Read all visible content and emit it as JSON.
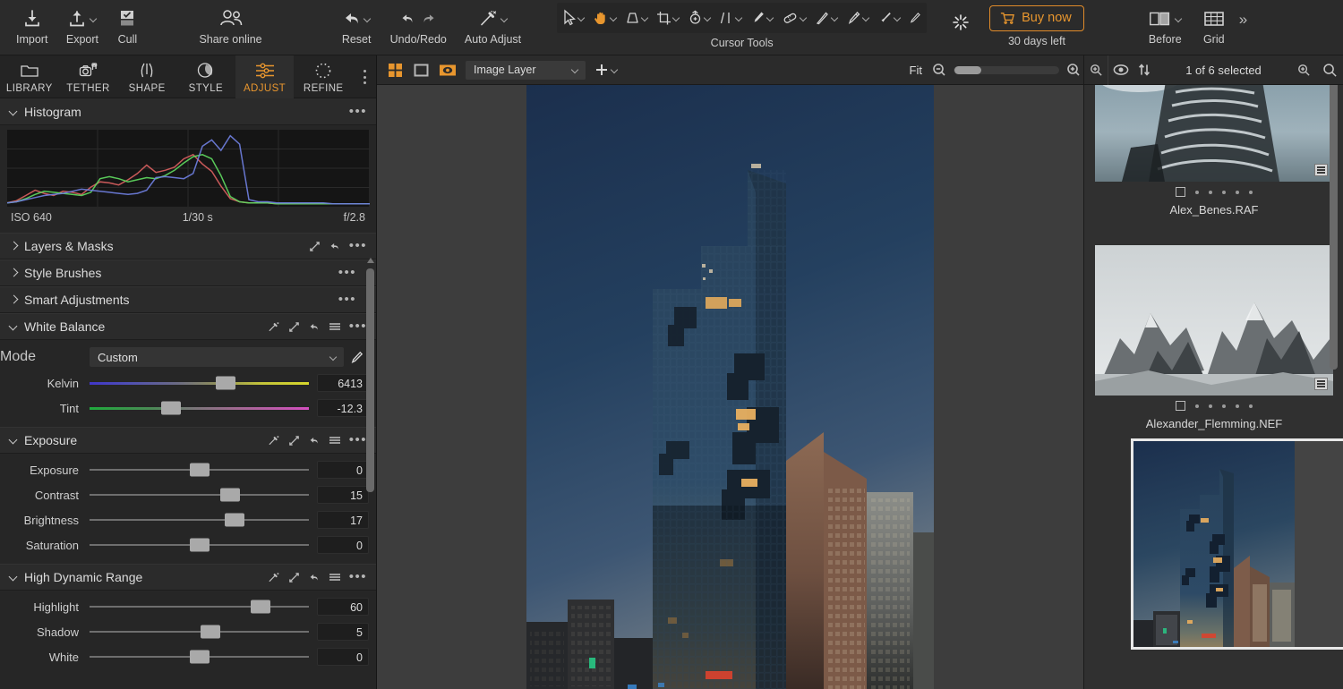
{
  "app": {
    "accent": "#e8962e",
    "panel_bg": "#262626",
    "toolbar_bg": "#2b2b2b"
  },
  "toolbar": {
    "items": [
      {
        "label": "Import",
        "icon": "import-icon",
        "caret": false
      },
      {
        "label": "Export",
        "icon": "export-icon",
        "caret": true
      },
      {
        "label": "Cull",
        "icon": "cull-icon",
        "caret": false
      },
      {
        "label": "Share online",
        "icon": "share-online-icon",
        "caret": false
      },
      {
        "label": "Reset",
        "icon": "reset-icon",
        "caret": true
      },
      {
        "label": "Undo/Redo",
        "icon": "undo-redo-icon",
        "caret": false
      },
      {
        "label": "Auto Adjust",
        "icon": "auto-adjust-icon",
        "caret": true
      }
    ],
    "cursor_tools_label": "Cursor Tools",
    "cursor_tools": [
      {
        "name": "select-tool",
        "active": false
      },
      {
        "name": "pan-tool",
        "active": true
      },
      {
        "name": "keystone-tool",
        "active": false
      },
      {
        "name": "crop-tool",
        "active": false
      },
      {
        "name": "rotate-tool",
        "active": false
      },
      {
        "name": "straighten-tool",
        "active": false
      },
      {
        "name": "brush-tool",
        "active": false
      },
      {
        "name": "heal-tool",
        "active": false
      },
      {
        "name": "gradient-mask-tool",
        "active": false
      },
      {
        "name": "color-picker-tool",
        "active": false
      },
      {
        "name": "dodge-tool",
        "active": false
      },
      {
        "name": "erase-tool",
        "active": false
      }
    ],
    "magic_icon": "magic-wand-icon",
    "buy_label": "Buy now",
    "trial_label": "30 days left",
    "before_label": "Before",
    "grid_label": "Grid",
    "overflow_label": "»"
  },
  "left_panel": {
    "tabs": [
      {
        "label": "LIBRARY",
        "icon": "folder-icon",
        "active": false
      },
      {
        "label": "TETHER",
        "icon": "tether-camera-icon",
        "active": false
      },
      {
        "label": "SHAPE",
        "icon": "shape-icon",
        "active": false
      },
      {
        "label": "STYLE",
        "icon": "style-icon",
        "active": false
      },
      {
        "label": "ADJUST",
        "icon": "adjust-sliders-icon",
        "active": true
      },
      {
        "label": "REFINE",
        "icon": "refine-icon",
        "active": false
      }
    ],
    "sections": [
      {
        "id": "histogram",
        "title": "Histogram",
        "open": true,
        "iso": "ISO 640",
        "shutter": "1/30 s",
        "aperture": "f/2.8"
      },
      {
        "id": "layers_masks",
        "title": "Layers & Masks",
        "open": false
      },
      {
        "id": "style_brushes",
        "title": "Style Brushes",
        "open": false
      },
      {
        "id": "smart_adjustments",
        "title": "Smart Adjustments",
        "open": false
      },
      {
        "id": "white_balance",
        "title": "White Balance",
        "open": true,
        "mode_label": "Mode",
        "mode_value": "Custom",
        "sliders": [
          {
            "label": "Kelvin",
            "value": "6413",
            "pos": 62,
            "style": "kelvin"
          },
          {
            "label": "Tint",
            "value": "-12.3",
            "pos": 37,
            "style": "tint"
          }
        ]
      },
      {
        "id": "exposure",
        "title": "Exposure",
        "open": true,
        "sliders": [
          {
            "label": "Exposure",
            "value": "0",
            "pos": 50,
            "style": "plain"
          },
          {
            "label": "Contrast",
            "value": "15",
            "pos": 64,
            "style": "plain"
          },
          {
            "label": "Brightness",
            "value": "17",
            "pos": 66,
            "style": "plain"
          },
          {
            "label": "Saturation",
            "value": "0",
            "pos": 50,
            "style": "plain"
          }
        ]
      },
      {
        "id": "hdr",
        "title": "High Dynamic Range",
        "open": true,
        "sliders": [
          {
            "label": "Highlight",
            "value": "60",
            "pos": 78,
            "style": "plain"
          },
          {
            "label": "Shadow",
            "value": "5",
            "pos": 55,
            "style": "plain"
          },
          {
            "label": "White",
            "value": "0",
            "pos": 50,
            "style": "plain"
          }
        ]
      }
    ]
  },
  "viewer_bar": {
    "grid_view_icon": "grid-view-icon",
    "single_view_icon": "single-view-icon",
    "preview_icon": "preview-eye-icon",
    "layer_value": "Image Layer",
    "add_layer_icon": "plus-icon",
    "fit_label": "Fit",
    "zoom_out_icon": "zoom-out-icon",
    "zoom_in_icon": "zoom-in-icon"
  },
  "browser_bar": {
    "eye_icon": "visibility-icon",
    "sort_icon": "sort-arrows-icon",
    "selection_text": "1 of 6 selected",
    "filter_icon": "filter-zoom-icon",
    "search_icon": "search-icon"
  },
  "browser": {
    "thumbnails": [
      {
        "name": "Alex_Benes.RAF",
        "selected": false,
        "subject": "spiral-building-bw"
      },
      {
        "name": "Alexander_Flemming.NEF",
        "selected": false,
        "subject": "mountains-bw"
      },
      {
        "name": "",
        "selected": true,
        "subject": "skyscraper-dusk"
      }
    ]
  },
  "viewer": {
    "image_alt": "skyscraper-at-dusk"
  },
  "chart_data": {
    "type": "line",
    "title": "Histogram",
    "xlabel": "",
    "ylabel": "",
    "series": [
      {
        "name": "red",
        "color": "#d95f5f",
        "values": [
          2,
          4,
          9,
          14,
          11,
          9,
          13,
          12,
          10,
          17,
          22,
          21,
          19,
          24,
          30,
          38,
          31,
          33,
          36,
          44,
          48,
          39,
          32,
          18,
          6,
          3,
          2,
          2,
          2,
          1,
          1,
          1,
          1,
          1,
          1,
          1,
          1,
          1,
          1,
          1
        ]
      },
      {
        "name": "green",
        "color": "#5fd95f",
        "values": [
          2,
          3,
          6,
          10,
          13,
          12,
          11,
          10,
          9,
          12,
          25,
          27,
          25,
          22,
          24,
          26,
          25,
          28,
          33,
          40,
          46,
          48,
          44,
          28,
          8,
          3,
          2,
          2,
          2,
          1,
          1,
          1,
          1,
          1,
          1,
          1,
          1,
          1,
          1,
          1
        ]
      },
      {
        "name": "blue",
        "color": "#6f7fe0",
        "values": [
          2,
          3,
          5,
          7,
          9,
          10,
          11,
          13,
          15,
          14,
          13,
          12,
          11,
          10,
          11,
          14,
          26,
          27,
          26,
          25,
          30,
          56,
          62,
          52,
          66,
          58,
          5,
          3,
          3,
          2,
          2,
          2,
          2,
          2,
          2,
          1,
          1,
          1,
          1,
          1
        ]
      }
    ],
    "ylim": [
      0,
      70
    ]
  }
}
